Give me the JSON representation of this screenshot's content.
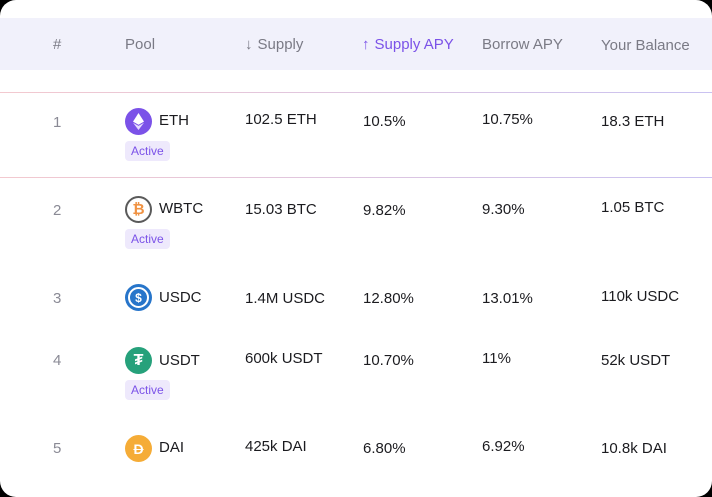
{
  "header": {
    "col_index": "#",
    "col_pool": "Pool",
    "col_supply": "Supply",
    "col_supply_apy": "Supply APY",
    "col_borrow_apy": "Borrow APY",
    "col_balance": "Your Balance",
    "supply_arrow": "↓",
    "supply_apy_arrow": "↑"
  },
  "colors": {
    "accent": "#7b52e8",
    "eth": "#7b52e8",
    "wbtc_bg": "#ffffff",
    "usdc": "#2775ca",
    "usdt": "#26a17b",
    "dai": "#f5ac37"
  },
  "rows": [
    {
      "index": "1",
      "symbol": "ETH",
      "icon": "eth-icon",
      "status": "Active",
      "supply": "102.5 ETH",
      "supply_apy": "10.5%",
      "borrow_apy": "10.75%",
      "balance": "18.3 ETH"
    },
    {
      "index": "2",
      "symbol": "WBTC",
      "icon": "wbtc-icon",
      "status": "Active",
      "supply": "15.03 BTC",
      "supply_apy": "9.82%",
      "borrow_apy": "9.30%",
      "balance": "1.05 BTC"
    },
    {
      "index": "3",
      "symbol": "USDC",
      "icon": "usdc-icon",
      "status": "",
      "supply": "1.4M USDC",
      "supply_apy": "12.80%",
      "borrow_apy": "13.01%",
      "balance": "110k USDC"
    },
    {
      "index": "4",
      "symbol": "USDT",
      "icon": "usdt-icon",
      "status": "Active",
      "supply": "600k USDT",
      "supply_apy": "10.70%",
      "borrow_apy": "11%",
      "balance": "52k USDT"
    },
    {
      "index": "5",
      "symbol": "DAI",
      "icon": "dai-icon",
      "status": "",
      "supply": "425k DAI",
      "supply_apy": "6.80%",
      "borrow_apy": "6.92%",
      "balance": "10.8k DAI"
    }
  ]
}
